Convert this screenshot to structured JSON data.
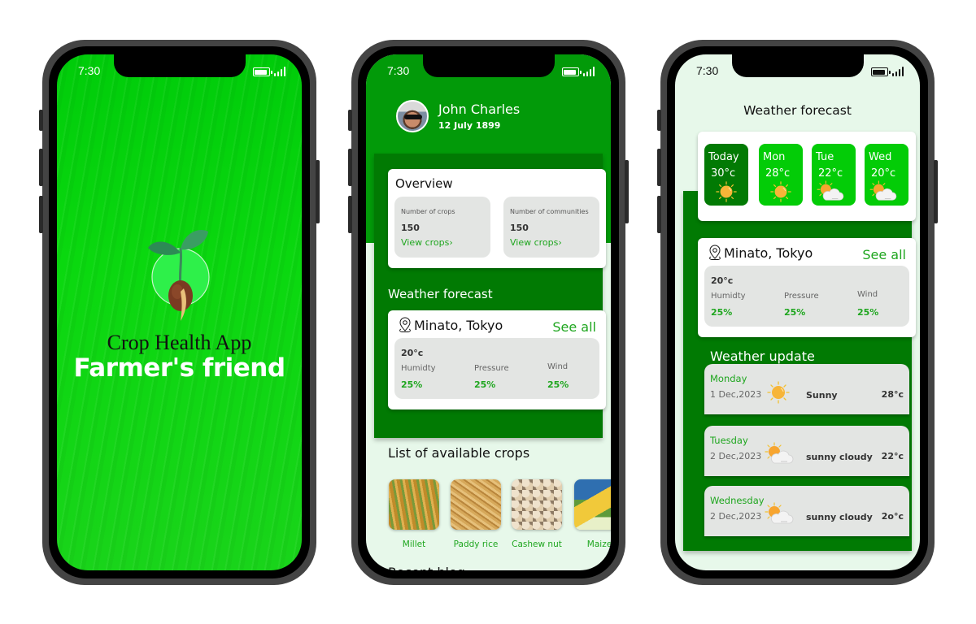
{
  "status_bar": {
    "time": "7:30"
  },
  "splash": {
    "subtitle": "Crop Health App",
    "title": "Farmer's friend",
    "bg_color": "#00cc0a"
  },
  "home": {
    "user": {
      "name": "John Charles",
      "date": "12 July 1899"
    },
    "overview": {
      "title": "Overview",
      "stats": [
        {
          "label": "Number of crops",
          "value": "150",
          "link": "View crops›"
        },
        {
          "label": "Number of communities",
          "value": "150",
          "link": "View crops›"
        }
      ]
    },
    "weather_forecast": {
      "title": "Weather forecast",
      "location": "Minato, Tokyo",
      "see_all": "See all",
      "temperature": "20°c",
      "metrics": [
        {
          "label": "Humidty",
          "value": "25%"
        },
        {
          "label": "Pressure",
          "value": "25%"
        },
        {
          "label": "Wind",
          "value": "25%"
        }
      ]
    },
    "crops": {
      "title": "List of available crops",
      "items": [
        {
          "name": "Millet"
        },
        {
          "name": "Paddy rice"
        },
        {
          "name": "Cashew nut"
        },
        {
          "name": "Maize"
        }
      ]
    },
    "recent_blog": {
      "title": "Recent blog"
    }
  },
  "forecast_screen": {
    "title": "Weather forecast",
    "days": [
      {
        "day": "Today",
        "temp": "30°c",
        "icon": "sun-icon"
      },
      {
        "day": "Mon",
        "temp": "28°c",
        "icon": "sun-icon"
      },
      {
        "day": "Tue",
        "temp": "22°c",
        "icon": "partly-cloudy-icon"
      },
      {
        "day": "Wed",
        "temp": "20°c",
        "icon": "partly-cloudy-icon"
      }
    ],
    "location_card": {
      "location": "Minato, Tokyo",
      "see_all": "See all",
      "temperature": "20°c",
      "metrics": [
        {
          "label": "Humidty",
          "value": "25%"
        },
        {
          "label": "Pressure",
          "value": "25%"
        },
        {
          "label": "Wind",
          "value": "25%"
        }
      ]
    },
    "weather_update": {
      "title": "Weather update",
      "rows": [
        {
          "day": "Monday",
          "date": "1 Dec,2023",
          "condition": "Sunny",
          "temp": "28°c",
          "icon": "sun-icon"
        },
        {
          "day": "Tuesday",
          "date": "2 Dec,2023",
          "condition": "sunny cloudy",
          "temp": "22°c",
          "icon": "partly-cloudy-icon"
        },
        {
          "day": "Wednesday",
          "date": "2 Dec,2023",
          "condition": "sunny cloudy",
          "temp": "2o°c",
          "icon": "partly-cloudy-icon"
        }
      ]
    }
  },
  "colors": {
    "primary_green": "#017a03",
    "bright_green": "#03cc07",
    "link_green": "#1fa61f",
    "panel_gray": "#e3e5e3",
    "light_bg": "#e7f8ea"
  }
}
